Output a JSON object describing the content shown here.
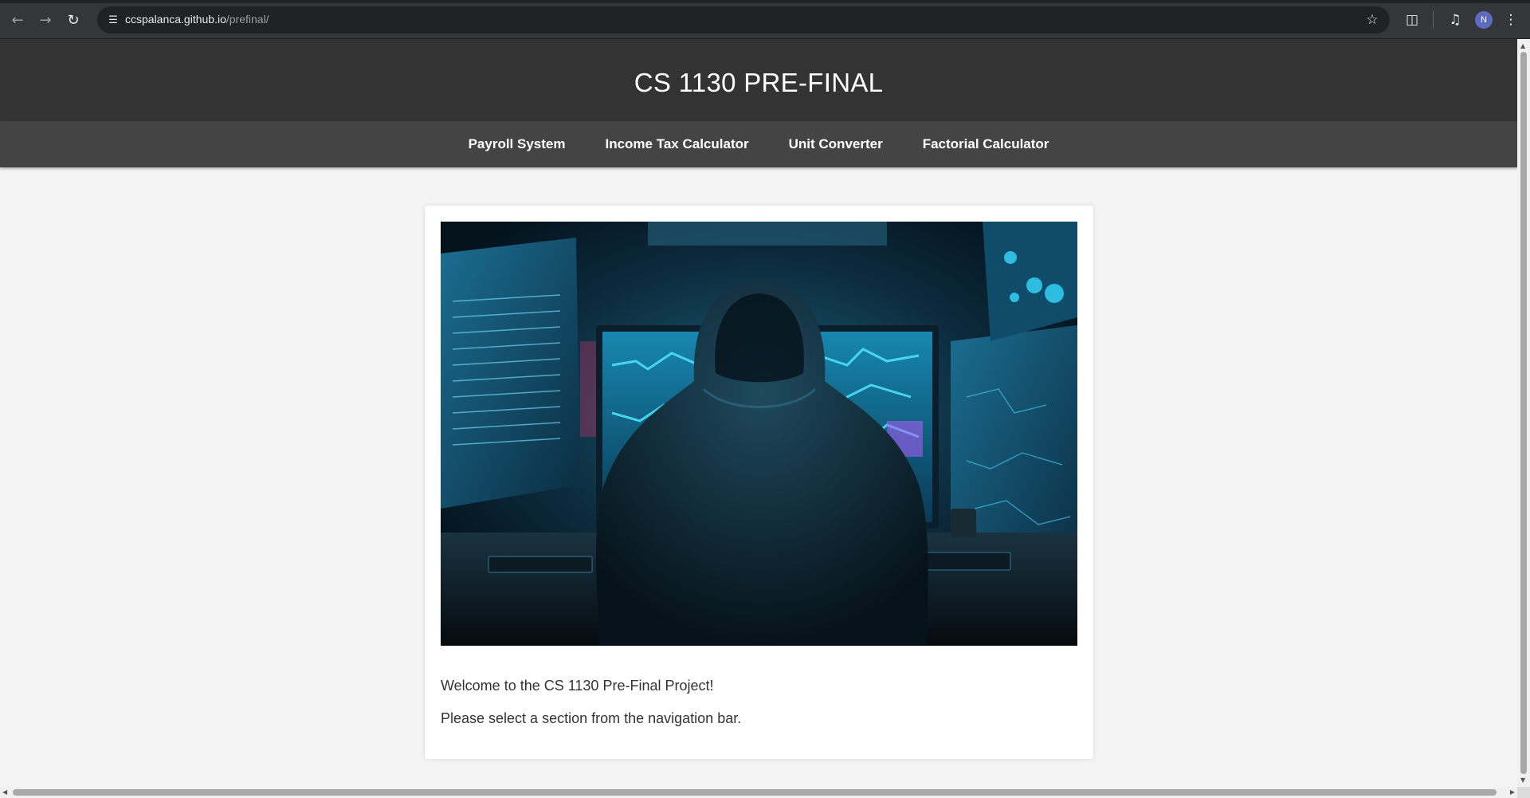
{
  "browser": {
    "url_host": "ccspalanca.github.io",
    "url_path": "/prefinal/",
    "avatar_initial": "N",
    "icons": {
      "back": "arrow-left-icon",
      "forward": "arrow-right-icon",
      "reload": "reload-icon",
      "site_info": "tune-icon",
      "bookmark": "star-icon",
      "extensions": "puzzle-icon",
      "media": "media-queue-icon",
      "menu": "kebab-menu-icon"
    }
  },
  "header": {
    "title": "CS 1130 PRE-FINAL"
  },
  "nav": {
    "items": [
      {
        "label": "Payroll System"
      },
      {
        "label": "Income Tax Calculator"
      },
      {
        "label": "Unit Converter"
      },
      {
        "label": "Factorial Calculator"
      }
    ]
  },
  "main": {
    "welcome": "Welcome to the CS 1130 Pre-Final Project!",
    "instruction": "Please select a section from the navigation bar."
  },
  "colors": {
    "header_bg": "#333333",
    "nav_bg": "#444444",
    "page_bg": "#f4f4f4",
    "card_bg": "#ffffff",
    "accent_cyan": "#2bc6e8"
  }
}
